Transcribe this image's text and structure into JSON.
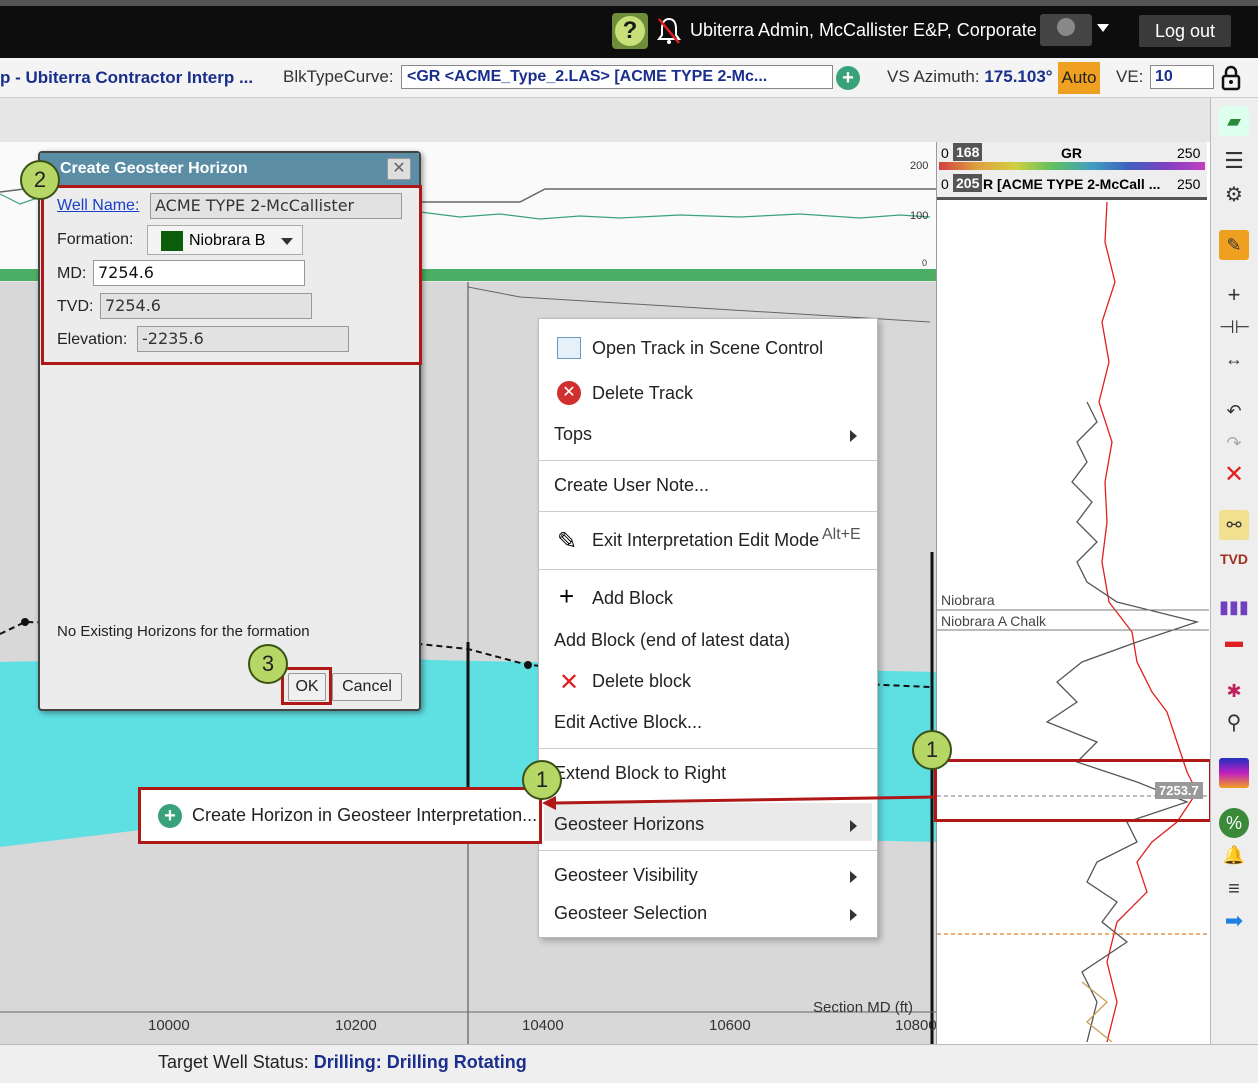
{
  "header": {
    "help_icon": "question-icon",
    "user_text": "Ubiterra Admin, McCallister E&P, Corporate",
    "logout_label": "Log out"
  },
  "toolbar": {
    "title": "p - Ubiterra Contractor Interp ...",
    "blk_label": "BlkTypeCurve:",
    "blk_value": "<GR <ACME_Type_2.LAS> [ACME TYPE 2-Mc...",
    "vs_label": "VS Azimuth:",
    "vs_value": "175.103°",
    "auto_label": "Auto",
    "ve_label": "VE:",
    "ve_value": "10"
  },
  "chart_top": {
    "tick_200": "200",
    "tick_100": "100",
    "tick_0": "0"
  },
  "log_panel": {
    "gr_min": "0",
    "gr_badge": "168",
    "gr_name": "GR",
    "gr_max": "250",
    "type_min": "0",
    "type_badge": "205",
    "type_name": "R [ACME TYPE 2-McCall ...",
    "type_max": "250",
    "top1": "Niobrara",
    "top2": "Niobrara A Chalk",
    "depth_flag": "7253.7"
  },
  "dialog": {
    "title": "Create Geosteer Horizon",
    "well_label": "Well Name:",
    "well_value": "ACME TYPE 2-McCallister",
    "formation_label": "Formation:",
    "formation_value": "Niobrara B",
    "formation_color": "#0b5c0b",
    "md_label": "MD:",
    "md_value": "7254.6",
    "tvd_label": "TVD:",
    "tvd_value": "7254.6",
    "elev_label": "Elevation:",
    "elev_value": "-2235.6",
    "no_horizons": "No Existing Horizons for the formation",
    "ok_label": "OK",
    "cancel_label": "Cancel"
  },
  "callouts": {
    "c1": "1",
    "c2": "2",
    "c3": "3"
  },
  "context_menu": {
    "open_track": "Open Track in Scene Control",
    "delete_track": "Delete Track",
    "tops": "Tops",
    "create_note": "Create User Note...",
    "exit_edit": "Exit Interpretation Edit Mode",
    "exit_shortcut": "Alt+E",
    "add_block": "Add Block",
    "add_block_end": "Add Block (end of latest data)",
    "delete_block": "Delete block",
    "edit_block": "Edit Active Block...",
    "extend_block": "Extend Block to Right",
    "geosteer_horizons": "Geosteer Horizons",
    "geosteer_visibility": "Geosteer Visibility",
    "geosteer_selection": "Geosteer Selection"
  },
  "submenu": {
    "create_horizon": "Create Horizon in Geosteer Interpretation..."
  },
  "section": {
    "axis_title": "Section MD (ft)",
    "ticks": [
      "10000",
      "10200",
      "10400",
      "10600",
      "10800"
    ]
  },
  "status": {
    "label": "Target Well Status:",
    "value": "Drilling: Drilling Rotating"
  },
  "colors": {
    "accent_blue": "#1a2f8c",
    "highlight_red": "#b01818",
    "cyan_fill": "#5ee0e3",
    "callout_green": "#b6d766"
  }
}
